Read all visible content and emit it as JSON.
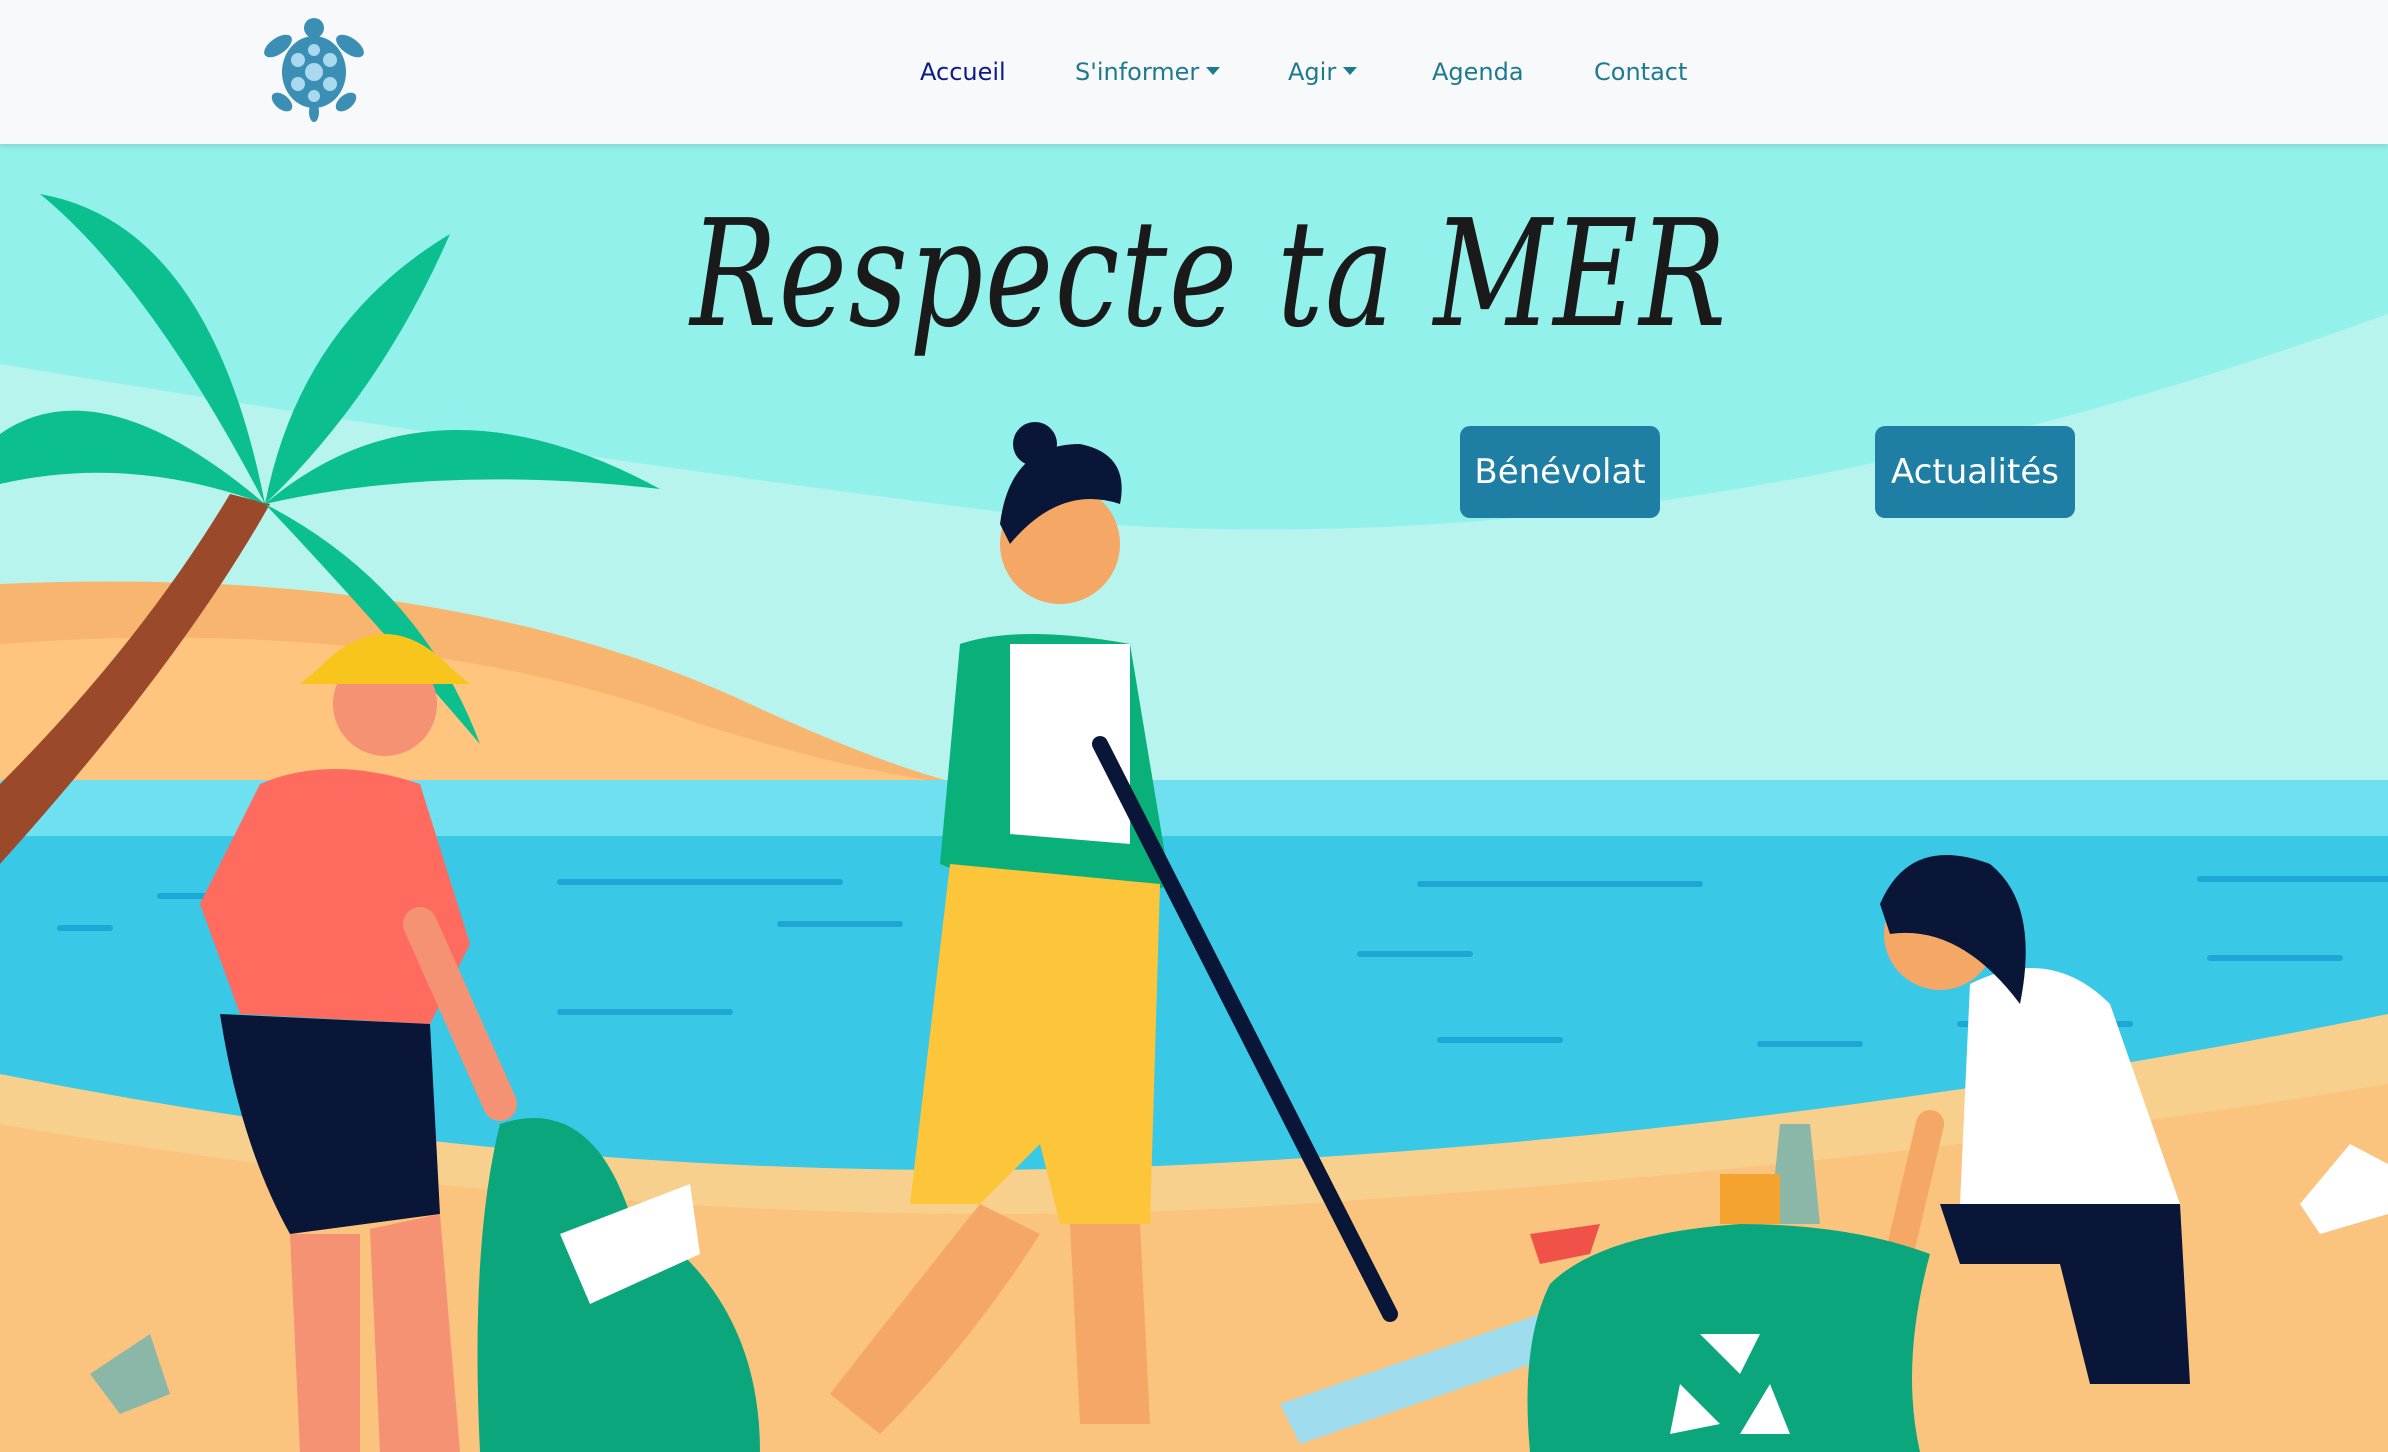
{
  "nav": {
    "logo": "turtle-icon",
    "links": [
      {
        "label": "Accueil",
        "active": true
      },
      {
        "label": "S'informer",
        "dropdown": true
      },
      {
        "label": "Agir",
        "dropdown": true
      },
      {
        "label": "Agenda"
      },
      {
        "label": "Contact"
      }
    ]
  },
  "hero": {
    "title": "Respecte ta MER",
    "buttons": {
      "volunteer": "Bénévolat",
      "news": "Actualités"
    },
    "illustration": "beach-cleanup-illustration"
  },
  "colors": {
    "accent": "#1e7ea3",
    "nav_link": "#1e7a8f",
    "nav_active": "#0d1a8a",
    "sky": "#93f1ec",
    "sea": "#39c8e6",
    "sand": "#fac98a"
  }
}
